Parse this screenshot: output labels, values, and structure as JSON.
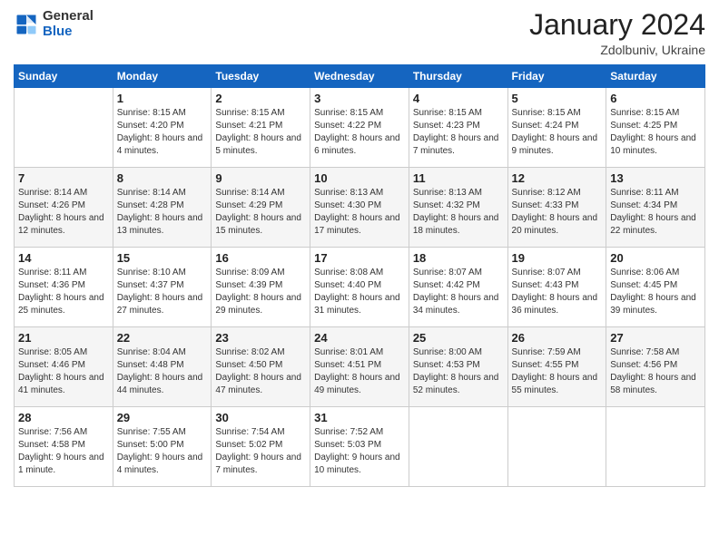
{
  "logo": {
    "general": "General",
    "blue": "Blue"
  },
  "header": {
    "month": "January 2024",
    "location": "Zdolbuniv, Ukraine"
  },
  "weekdays": [
    "Sunday",
    "Monday",
    "Tuesday",
    "Wednesday",
    "Thursday",
    "Friday",
    "Saturday"
  ],
  "weeks": [
    [
      {
        "day": "",
        "sunrise": "",
        "sunset": "",
        "daylight": ""
      },
      {
        "day": "1",
        "sunrise": "Sunrise: 8:15 AM",
        "sunset": "Sunset: 4:20 PM",
        "daylight": "Daylight: 8 hours and 4 minutes."
      },
      {
        "day": "2",
        "sunrise": "Sunrise: 8:15 AM",
        "sunset": "Sunset: 4:21 PM",
        "daylight": "Daylight: 8 hours and 5 minutes."
      },
      {
        "day": "3",
        "sunrise": "Sunrise: 8:15 AM",
        "sunset": "Sunset: 4:22 PM",
        "daylight": "Daylight: 8 hours and 6 minutes."
      },
      {
        "day": "4",
        "sunrise": "Sunrise: 8:15 AM",
        "sunset": "Sunset: 4:23 PM",
        "daylight": "Daylight: 8 hours and 7 minutes."
      },
      {
        "day": "5",
        "sunrise": "Sunrise: 8:15 AM",
        "sunset": "Sunset: 4:24 PM",
        "daylight": "Daylight: 8 hours and 9 minutes."
      },
      {
        "day": "6",
        "sunrise": "Sunrise: 8:15 AM",
        "sunset": "Sunset: 4:25 PM",
        "daylight": "Daylight: 8 hours and 10 minutes."
      }
    ],
    [
      {
        "day": "7",
        "sunrise": "Sunrise: 8:14 AM",
        "sunset": "Sunset: 4:26 PM",
        "daylight": "Daylight: 8 hours and 12 minutes."
      },
      {
        "day": "8",
        "sunrise": "Sunrise: 8:14 AM",
        "sunset": "Sunset: 4:28 PM",
        "daylight": "Daylight: 8 hours and 13 minutes."
      },
      {
        "day": "9",
        "sunrise": "Sunrise: 8:14 AM",
        "sunset": "Sunset: 4:29 PM",
        "daylight": "Daylight: 8 hours and 15 minutes."
      },
      {
        "day": "10",
        "sunrise": "Sunrise: 8:13 AM",
        "sunset": "Sunset: 4:30 PM",
        "daylight": "Daylight: 8 hours and 17 minutes."
      },
      {
        "day": "11",
        "sunrise": "Sunrise: 8:13 AM",
        "sunset": "Sunset: 4:32 PM",
        "daylight": "Daylight: 8 hours and 18 minutes."
      },
      {
        "day": "12",
        "sunrise": "Sunrise: 8:12 AM",
        "sunset": "Sunset: 4:33 PM",
        "daylight": "Daylight: 8 hours and 20 minutes."
      },
      {
        "day": "13",
        "sunrise": "Sunrise: 8:11 AM",
        "sunset": "Sunset: 4:34 PM",
        "daylight": "Daylight: 8 hours and 22 minutes."
      }
    ],
    [
      {
        "day": "14",
        "sunrise": "Sunrise: 8:11 AM",
        "sunset": "Sunset: 4:36 PM",
        "daylight": "Daylight: 8 hours and 25 minutes."
      },
      {
        "day": "15",
        "sunrise": "Sunrise: 8:10 AM",
        "sunset": "Sunset: 4:37 PM",
        "daylight": "Daylight: 8 hours and 27 minutes."
      },
      {
        "day": "16",
        "sunrise": "Sunrise: 8:09 AM",
        "sunset": "Sunset: 4:39 PM",
        "daylight": "Daylight: 8 hours and 29 minutes."
      },
      {
        "day": "17",
        "sunrise": "Sunrise: 8:08 AM",
        "sunset": "Sunset: 4:40 PM",
        "daylight": "Daylight: 8 hours and 31 minutes."
      },
      {
        "day": "18",
        "sunrise": "Sunrise: 8:07 AM",
        "sunset": "Sunset: 4:42 PM",
        "daylight": "Daylight: 8 hours and 34 minutes."
      },
      {
        "day": "19",
        "sunrise": "Sunrise: 8:07 AM",
        "sunset": "Sunset: 4:43 PM",
        "daylight": "Daylight: 8 hours and 36 minutes."
      },
      {
        "day": "20",
        "sunrise": "Sunrise: 8:06 AM",
        "sunset": "Sunset: 4:45 PM",
        "daylight": "Daylight: 8 hours and 39 minutes."
      }
    ],
    [
      {
        "day": "21",
        "sunrise": "Sunrise: 8:05 AM",
        "sunset": "Sunset: 4:46 PM",
        "daylight": "Daylight: 8 hours and 41 minutes."
      },
      {
        "day": "22",
        "sunrise": "Sunrise: 8:04 AM",
        "sunset": "Sunset: 4:48 PM",
        "daylight": "Daylight: 8 hours and 44 minutes."
      },
      {
        "day": "23",
        "sunrise": "Sunrise: 8:02 AM",
        "sunset": "Sunset: 4:50 PM",
        "daylight": "Daylight: 8 hours and 47 minutes."
      },
      {
        "day": "24",
        "sunrise": "Sunrise: 8:01 AM",
        "sunset": "Sunset: 4:51 PM",
        "daylight": "Daylight: 8 hours and 49 minutes."
      },
      {
        "day": "25",
        "sunrise": "Sunrise: 8:00 AM",
        "sunset": "Sunset: 4:53 PM",
        "daylight": "Daylight: 8 hours and 52 minutes."
      },
      {
        "day": "26",
        "sunrise": "Sunrise: 7:59 AM",
        "sunset": "Sunset: 4:55 PM",
        "daylight": "Daylight: 8 hours and 55 minutes."
      },
      {
        "day": "27",
        "sunrise": "Sunrise: 7:58 AM",
        "sunset": "Sunset: 4:56 PM",
        "daylight": "Daylight: 8 hours and 58 minutes."
      }
    ],
    [
      {
        "day": "28",
        "sunrise": "Sunrise: 7:56 AM",
        "sunset": "Sunset: 4:58 PM",
        "daylight": "Daylight: 9 hours and 1 minute."
      },
      {
        "day": "29",
        "sunrise": "Sunrise: 7:55 AM",
        "sunset": "Sunset: 5:00 PM",
        "daylight": "Daylight: 9 hours and 4 minutes."
      },
      {
        "day": "30",
        "sunrise": "Sunrise: 7:54 AM",
        "sunset": "Sunset: 5:02 PM",
        "daylight": "Daylight: 9 hours and 7 minutes."
      },
      {
        "day": "31",
        "sunrise": "Sunrise: 7:52 AM",
        "sunset": "Sunset: 5:03 PM",
        "daylight": "Daylight: 9 hours and 10 minutes."
      },
      {
        "day": "",
        "sunrise": "",
        "sunset": "",
        "daylight": ""
      },
      {
        "day": "",
        "sunrise": "",
        "sunset": "",
        "daylight": ""
      },
      {
        "day": "",
        "sunrise": "",
        "sunset": "",
        "daylight": ""
      }
    ]
  ]
}
